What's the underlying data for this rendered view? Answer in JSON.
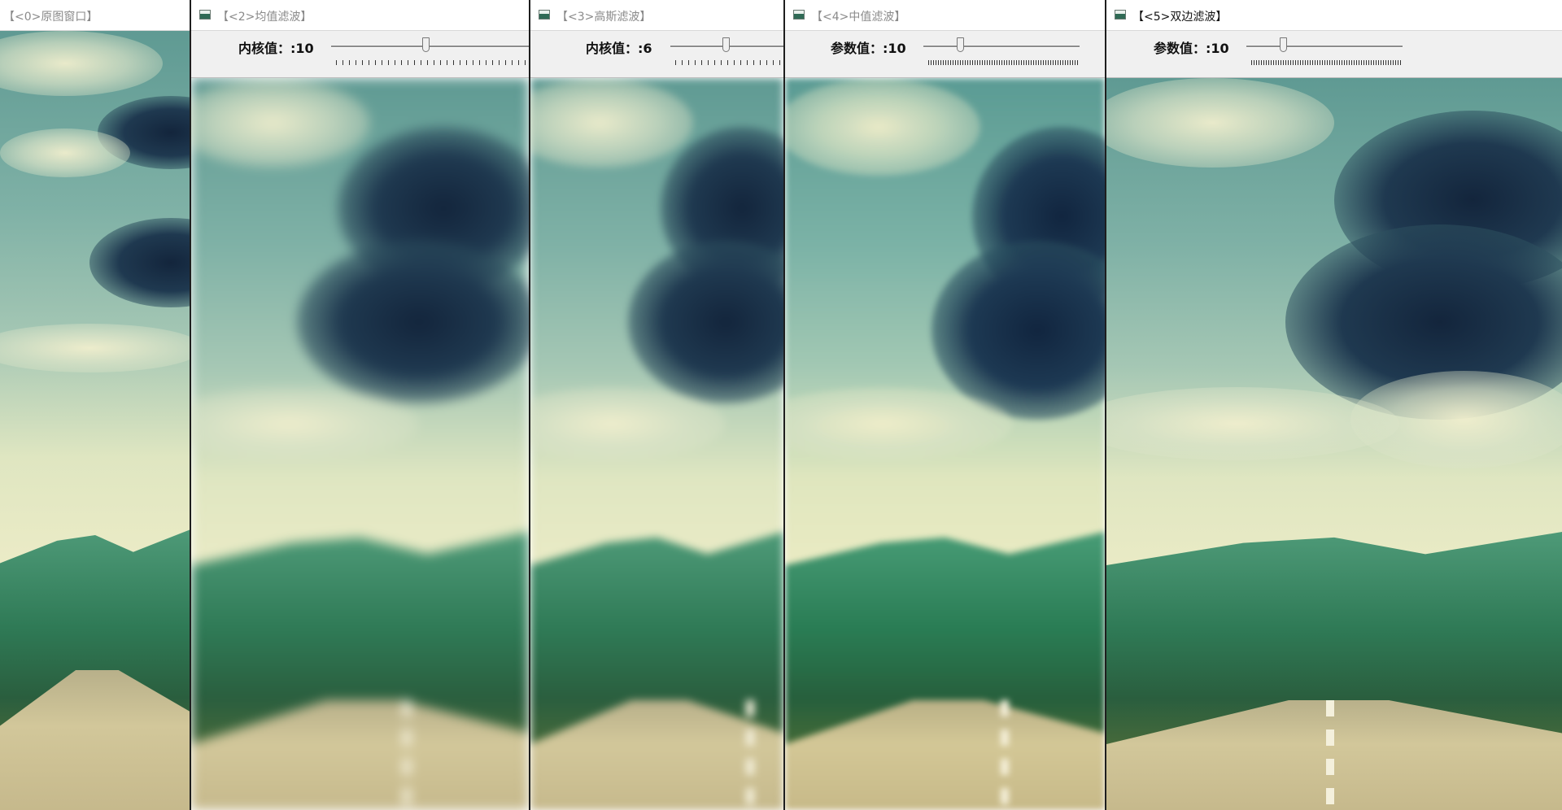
{
  "windows": [
    {
      "title": "【<0>原图窗口】",
      "has_icon": false,
      "active": false
    },
    {
      "title": "【<2>均值滤波】",
      "has_icon": true,
      "active": false,
      "trackbar": {
        "label": "内核值：",
        "value": "10"
      }
    },
    {
      "title": "【<3>高斯滤波】",
      "has_icon": true,
      "active": false,
      "trackbar": {
        "label": "内核值：",
        "value": "6"
      }
    },
    {
      "title": "【<4>中值滤波】",
      "has_icon": true,
      "active": false,
      "trackbar": {
        "label": "参数值：",
        "value": "10"
      }
    },
    {
      "title": "【<5>双边滤波】",
      "has_icon": true,
      "active": true,
      "trackbar": {
        "label": "参数值：",
        "value": "10"
      }
    }
  ],
  "colors": {
    "titlebar_bg": "#ffffff",
    "trackbar_bg": "#f0f0f0",
    "inactive_title": "#8a8a8a",
    "active_title": "#111111"
  },
  "icons": {
    "window_icon": "opencv-window-icon",
    "slider_thumb": "slider-thumb-icon"
  }
}
